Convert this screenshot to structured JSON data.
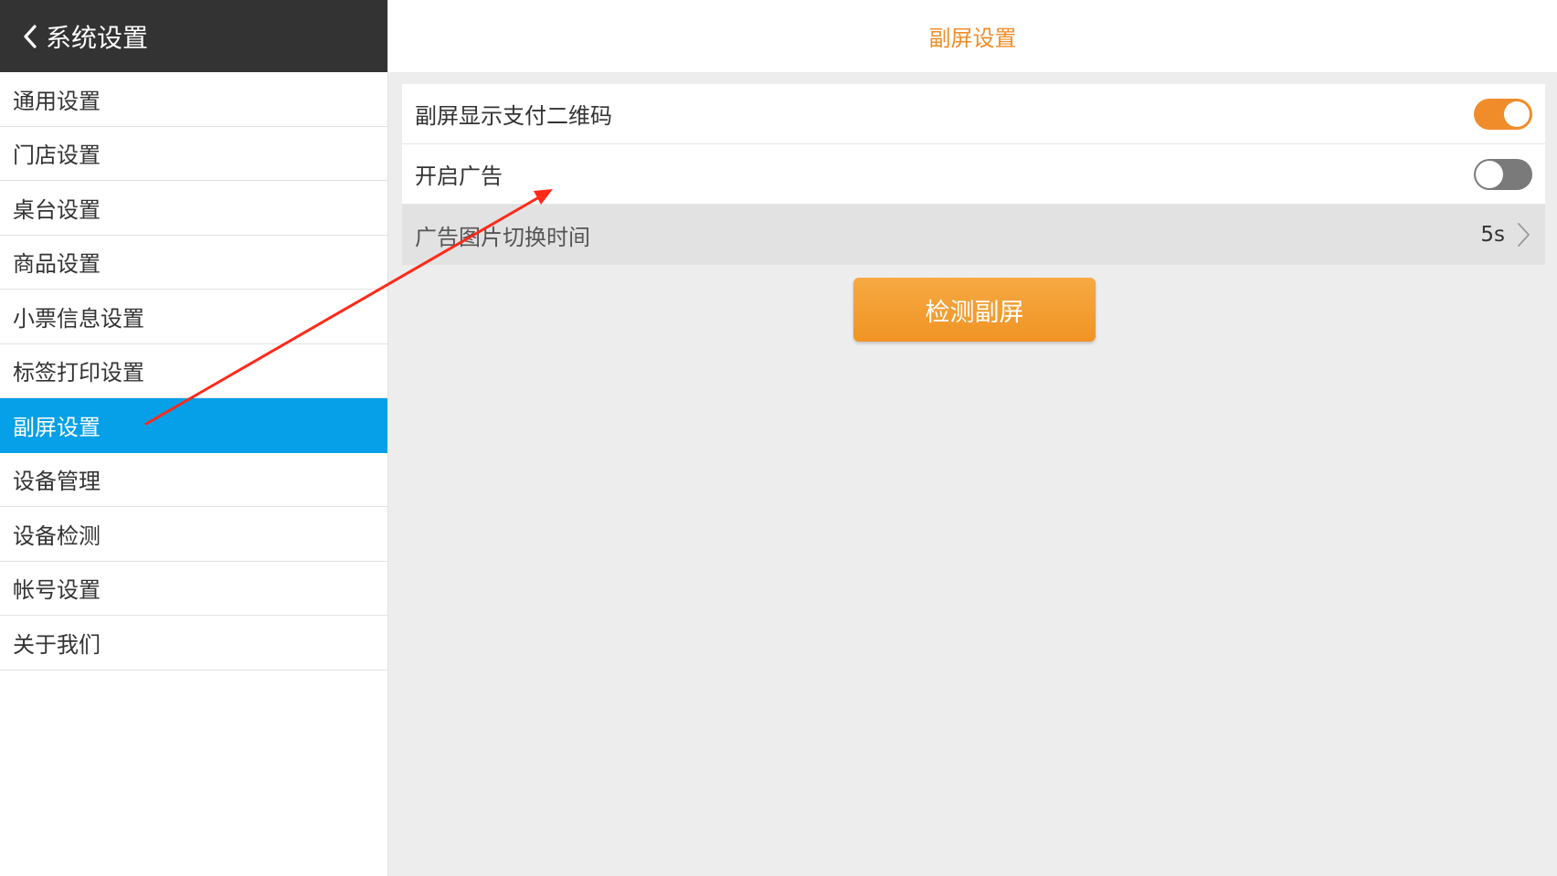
{
  "sidebar": {
    "back_title": "系统设置",
    "items": [
      {
        "label": "通用设置"
      },
      {
        "label": "门店设置"
      },
      {
        "label": "桌台设置"
      },
      {
        "label": "商品设置"
      },
      {
        "label": "小票信息设置"
      },
      {
        "label": "标签打印设置"
      },
      {
        "label": "副屏设置",
        "active": true
      },
      {
        "label": "设备管理"
      },
      {
        "label": "设备检测"
      },
      {
        "label": "帐号设置"
      },
      {
        "label": "关于我们"
      }
    ]
  },
  "main": {
    "title": "副屏设置",
    "settings": {
      "show_pay_qr": {
        "label": "副屏显示支付二维码",
        "enabled": true
      },
      "enable_ads": {
        "label": "开启广告",
        "enabled": false
      },
      "ad_interval": {
        "label": "广告图片切换时间",
        "value": "5s"
      }
    },
    "detect_button_label": "检测副屏"
  },
  "colors": {
    "accent": "#f08d2a",
    "selected": "#05a0e8",
    "header_dark": "#333333",
    "annotation_arrow": "#ff2a1a"
  }
}
